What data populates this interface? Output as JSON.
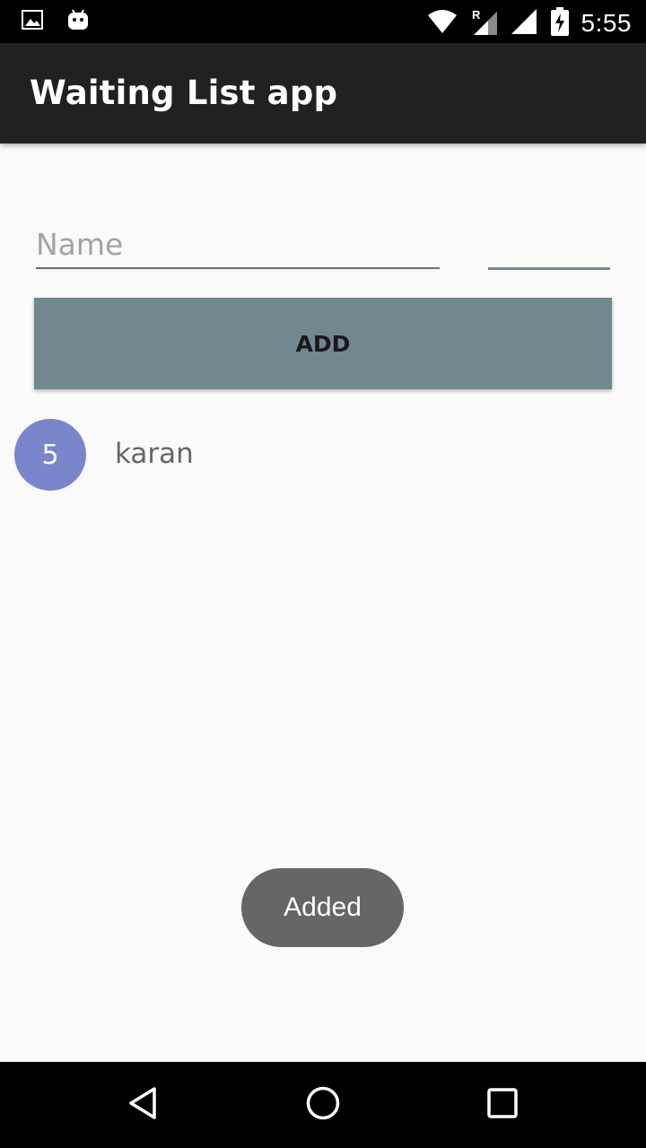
{
  "status_bar": {
    "time": "5:55",
    "icons": [
      "image-notification-icon",
      "android-notification-icon",
      "wifi-icon",
      "roaming-signal-icon",
      "signal-icon",
      "battery-charging-icon"
    ],
    "roaming_label": "R"
  },
  "app_bar": {
    "title": "Waiting List app",
    "background": "#212121"
  },
  "form": {
    "name_placeholder": "Name",
    "name_value": "",
    "party_size_value": "",
    "add_label": "ADD",
    "button_color": "#728891"
  },
  "guests": [
    {
      "party_size": "5",
      "name": "karan",
      "badge_color": "#7986cb"
    }
  ],
  "toast": {
    "message": "Added"
  },
  "nav_bar": {
    "buttons": [
      "back-icon",
      "home-icon",
      "recents-icon"
    ]
  }
}
